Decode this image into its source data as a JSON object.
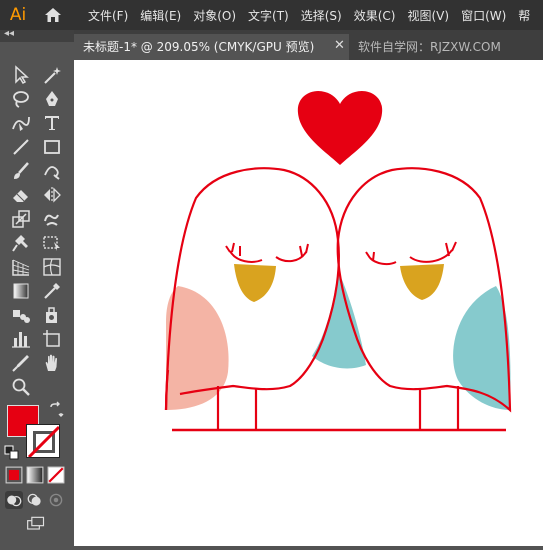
{
  "app": {
    "logo_text": "Ai"
  },
  "menu": [
    {
      "label": "文件(F)"
    },
    {
      "label": "编辑(E)"
    },
    {
      "label": "对象(O)"
    },
    {
      "label": "文字(T)"
    },
    {
      "label": "选择(S)"
    },
    {
      "label": "效果(C)"
    },
    {
      "label": "视图(V)"
    },
    {
      "label": "窗口(W)"
    },
    {
      "label": "帮"
    }
  ],
  "tabs": {
    "active_label": "未标题-1* @ 209.05% (CMYK/GPU 预览)",
    "close_glyph": "✕",
    "inactive_label": "软件自学网：RJZXW.COM"
  },
  "toolbar": {
    "collapse_glyph": "◂◂"
  },
  "colors": {
    "fill": "#E60012",
    "heart": "#E60012",
    "outline": "#E60012",
    "beak": "#D9A31F",
    "cheek": "#F4B4A5",
    "wing": "#86CACD",
    "canvas": "#FFFFFF",
    "ui_dark": "#323232",
    "ui_panel": "#535353",
    "logo": "#FF9A00"
  }
}
